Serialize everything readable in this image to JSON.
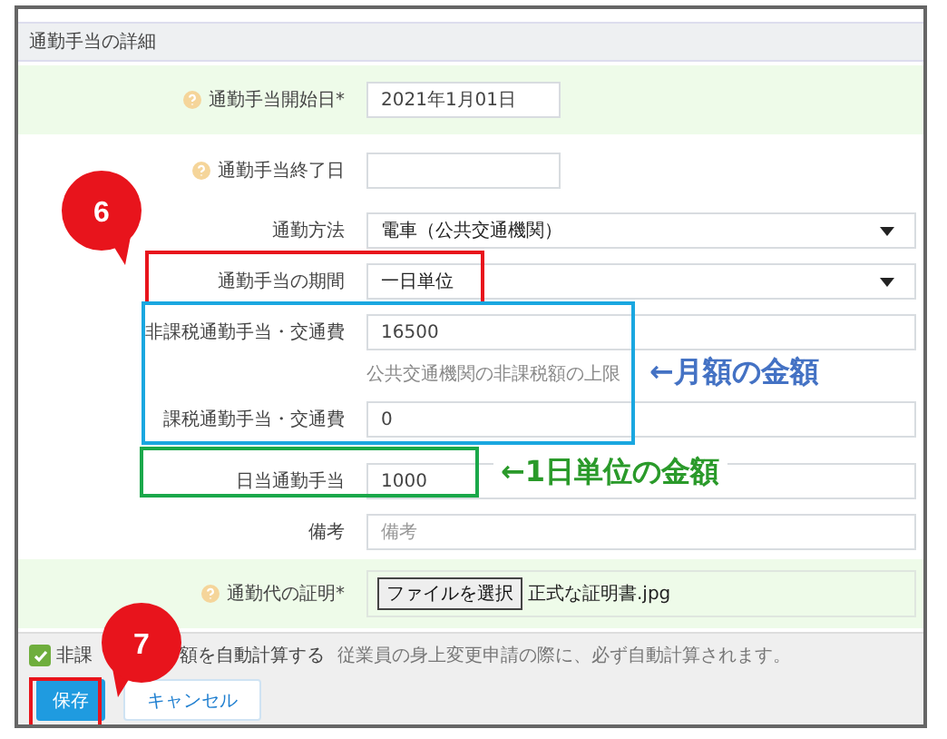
{
  "section_title": "通勤手当の詳細",
  "fields": [
    {
      "kind": "date",
      "label": "通勤手当開始日*",
      "help": true,
      "highlighted": true,
      "value": "2021年1月01日"
    },
    {
      "kind": "date",
      "label": "通勤手当終了日",
      "help": true,
      "highlighted": false
    },
    {
      "kind": "select",
      "label": "通勤方法",
      "help": false,
      "highlighted": false,
      "value": "電車（公共交通機関）"
    },
    {
      "kind": "select",
      "label": "通勤手当の期間",
      "help": false,
      "highlighted": false,
      "value": "一日単位"
    },
    {
      "kind": "text",
      "label": "非課税通勤手当・交通費",
      "help": false,
      "highlighted": false,
      "value": "16500",
      "hint": "公共交通機関の非課税額の上限"
    },
    {
      "kind": "text",
      "label": "課税通勤手当・交通費",
      "help": false,
      "highlighted": false,
      "value": "0"
    },
    {
      "kind": "text",
      "label": "日当通勤手当",
      "help": false,
      "highlighted": false,
      "value": "1000"
    },
    {
      "kind": "text",
      "label": "備考",
      "help": false,
      "highlighted": false,
      "placeholder": "備考"
    },
    {
      "kind": "file",
      "label": "通勤代の証明*",
      "help": true,
      "highlighted": true,
      "button": "ファイルを選択",
      "file": "正式な証明書.jpg"
    }
  ],
  "footer": {
    "checked": true,
    "label_start": "非課",
    "label_end": "額を自動計算する",
    "note": "従業員の身上変更申請の際に、必ず自動計算されます。"
  },
  "buttons": [
    {
      "label": "保存",
      "kind": "primary"
    },
    {
      "label": "キャンセル",
      "kind": "secondary"
    }
  ],
  "annotations": {
    "markers": [
      "6",
      "7"
    ],
    "notes": [
      {
        "text": "←月額の金額",
        "color": "#4472c4"
      },
      {
        "text": "←1日単位の金額",
        "color": "#2a9a2a"
      }
    ],
    "boxes": [
      {
        "color": "#e8141c"
      },
      {
        "color": "#1aa7e0"
      },
      {
        "color": "#1aa84a"
      },
      {
        "color": "#e8141c"
      }
    ]
  }
}
